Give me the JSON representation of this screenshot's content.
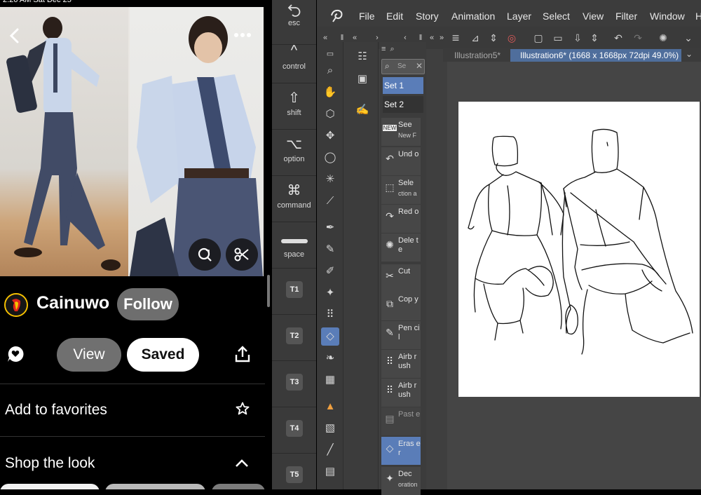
{
  "status_bar": {
    "text": "2:26 AM   Sat Dec 25"
  },
  "pinterest": {
    "username": "Cainuwo",
    "follow_label": "Follow",
    "view_label": "View",
    "saved_label": "Saved",
    "add_favorites_label": "Add to favorites",
    "shop_look_label": "Shop the look"
  },
  "keys": {
    "esc": "esc",
    "control": "control",
    "shift": "shift",
    "option": "option",
    "command": "command",
    "space": "space",
    "t1": "T1",
    "t2": "T2",
    "t3": "T3",
    "t4": "T4",
    "t5": "T5"
  },
  "csp": {
    "menus": [
      "File",
      "Edit",
      "Story",
      "Animation",
      "Layer",
      "Select",
      "View",
      "Filter",
      "Window",
      "H"
    ],
    "tabs": {
      "tab1": "Illustration5*",
      "tab2": "Illustration6* (1668 x 1668px 72dpi 49.0%)"
    },
    "search_placeholder": "Se",
    "sets": [
      "Set 1",
      "Set 2"
    ],
    "subtools": [
      {
        "label": "See",
        "sub": "New F",
        "icon": "new-icon"
      },
      {
        "label": "Und o",
        "sub": "",
        "icon": "undo-icon"
      },
      {
        "label": "Sele",
        "sub": "ction a",
        "icon": "selection-icon"
      },
      {
        "label": "Red o",
        "sub": "",
        "icon": "redo-icon"
      },
      {
        "label": "Dele te",
        "sub": "",
        "icon": "delete-icon"
      },
      {
        "label": "Cut",
        "sub": "",
        "icon": "scissors-icon"
      },
      {
        "label": "Cop y",
        "sub": "",
        "icon": "copy-icon"
      },
      {
        "label": "Pen cil",
        "sub": "",
        "icon": "pencil-icon"
      },
      {
        "label": "Airb rush",
        "sub": "",
        "icon": "airbrush-icon"
      },
      {
        "label": "Airb rush",
        "sub": "",
        "icon": "airbrush-icon"
      },
      {
        "label": "Past e",
        "sub": "",
        "icon": "paste-icon"
      },
      {
        "label": "Eras er",
        "sub": "",
        "icon": "eraser-icon"
      },
      {
        "label": "Dec",
        "sub": "oration",
        "icon": "decoration-icon"
      }
    ]
  }
}
